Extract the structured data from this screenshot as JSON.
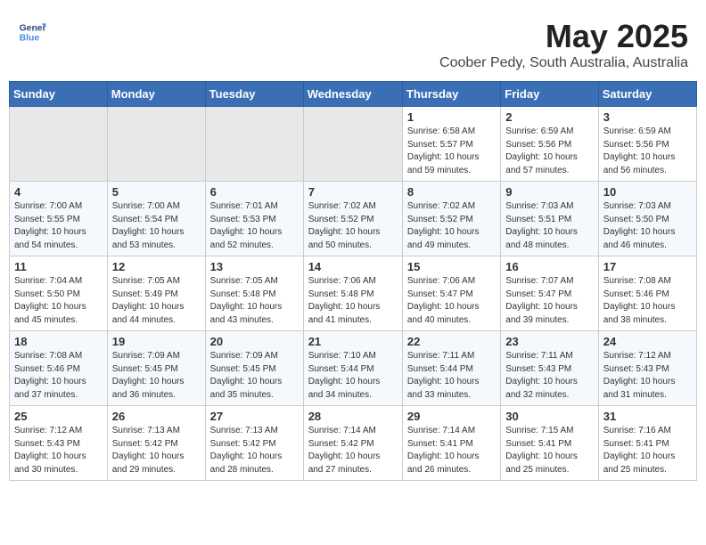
{
  "logo": {
    "line1": "General",
    "line2": "Blue"
  },
  "title": "May 2025",
  "subtitle": "Coober Pedy, South Australia, Australia",
  "days_of_week": [
    "Sunday",
    "Monday",
    "Tuesday",
    "Wednesday",
    "Thursday",
    "Friday",
    "Saturday"
  ],
  "weeks": [
    [
      {
        "day": "",
        "info": ""
      },
      {
        "day": "",
        "info": ""
      },
      {
        "day": "",
        "info": ""
      },
      {
        "day": "",
        "info": ""
      },
      {
        "day": "1",
        "info": "Sunrise: 6:58 AM\nSunset: 5:57 PM\nDaylight: 10 hours\nand 59 minutes."
      },
      {
        "day": "2",
        "info": "Sunrise: 6:59 AM\nSunset: 5:56 PM\nDaylight: 10 hours\nand 57 minutes."
      },
      {
        "day": "3",
        "info": "Sunrise: 6:59 AM\nSunset: 5:56 PM\nDaylight: 10 hours\nand 56 minutes."
      }
    ],
    [
      {
        "day": "4",
        "info": "Sunrise: 7:00 AM\nSunset: 5:55 PM\nDaylight: 10 hours\nand 54 minutes."
      },
      {
        "day": "5",
        "info": "Sunrise: 7:00 AM\nSunset: 5:54 PM\nDaylight: 10 hours\nand 53 minutes."
      },
      {
        "day": "6",
        "info": "Sunrise: 7:01 AM\nSunset: 5:53 PM\nDaylight: 10 hours\nand 52 minutes."
      },
      {
        "day": "7",
        "info": "Sunrise: 7:02 AM\nSunset: 5:52 PM\nDaylight: 10 hours\nand 50 minutes."
      },
      {
        "day": "8",
        "info": "Sunrise: 7:02 AM\nSunset: 5:52 PM\nDaylight: 10 hours\nand 49 minutes."
      },
      {
        "day": "9",
        "info": "Sunrise: 7:03 AM\nSunset: 5:51 PM\nDaylight: 10 hours\nand 48 minutes."
      },
      {
        "day": "10",
        "info": "Sunrise: 7:03 AM\nSunset: 5:50 PM\nDaylight: 10 hours\nand 46 minutes."
      }
    ],
    [
      {
        "day": "11",
        "info": "Sunrise: 7:04 AM\nSunset: 5:50 PM\nDaylight: 10 hours\nand 45 minutes."
      },
      {
        "day": "12",
        "info": "Sunrise: 7:05 AM\nSunset: 5:49 PM\nDaylight: 10 hours\nand 44 minutes."
      },
      {
        "day": "13",
        "info": "Sunrise: 7:05 AM\nSunset: 5:48 PM\nDaylight: 10 hours\nand 43 minutes."
      },
      {
        "day": "14",
        "info": "Sunrise: 7:06 AM\nSunset: 5:48 PM\nDaylight: 10 hours\nand 41 minutes."
      },
      {
        "day": "15",
        "info": "Sunrise: 7:06 AM\nSunset: 5:47 PM\nDaylight: 10 hours\nand 40 minutes."
      },
      {
        "day": "16",
        "info": "Sunrise: 7:07 AM\nSunset: 5:47 PM\nDaylight: 10 hours\nand 39 minutes."
      },
      {
        "day": "17",
        "info": "Sunrise: 7:08 AM\nSunset: 5:46 PM\nDaylight: 10 hours\nand 38 minutes."
      }
    ],
    [
      {
        "day": "18",
        "info": "Sunrise: 7:08 AM\nSunset: 5:46 PM\nDaylight: 10 hours\nand 37 minutes."
      },
      {
        "day": "19",
        "info": "Sunrise: 7:09 AM\nSunset: 5:45 PM\nDaylight: 10 hours\nand 36 minutes."
      },
      {
        "day": "20",
        "info": "Sunrise: 7:09 AM\nSunset: 5:45 PM\nDaylight: 10 hours\nand 35 minutes."
      },
      {
        "day": "21",
        "info": "Sunrise: 7:10 AM\nSunset: 5:44 PM\nDaylight: 10 hours\nand 34 minutes."
      },
      {
        "day": "22",
        "info": "Sunrise: 7:11 AM\nSunset: 5:44 PM\nDaylight: 10 hours\nand 33 minutes."
      },
      {
        "day": "23",
        "info": "Sunrise: 7:11 AM\nSunset: 5:43 PM\nDaylight: 10 hours\nand 32 minutes."
      },
      {
        "day": "24",
        "info": "Sunrise: 7:12 AM\nSunset: 5:43 PM\nDaylight: 10 hours\nand 31 minutes."
      }
    ],
    [
      {
        "day": "25",
        "info": "Sunrise: 7:12 AM\nSunset: 5:43 PM\nDaylight: 10 hours\nand 30 minutes."
      },
      {
        "day": "26",
        "info": "Sunrise: 7:13 AM\nSunset: 5:42 PM\nDaylight: 10 hours\nand 29 minutes."
      },
      {
        "day": "27",
        "info": "Sunrise: 7:13 AM\nSunset: 5:42 PM\nDaylight: 10 hours\nand 28 minutes."
      },
      {
        "day": "28",
        "info": "Sunrise: 7:14 AM\nSunset: 5:42 PM\nDaylight: 10 hours\nand 27 minutes."
      },
      {
        "day": "29",
        "info": "Sunrise: 7:14 AM\nSunset: 5:41 PM\nDaylight: 10 hours\nand 26 minutes."
      },
      {
        "day": "30",
        "info": "Sunrise: 7:15 AM\nSunset: 5:41 PM\nDaylight: 10 hours\nand 25 minutes."
      },
      {
        "day": "31",
        "info": "Sunrise: 7:16 AM\nSunset: 5:41 PM\nDaylight: 10 hours\nand 25 minutes."
      }
    ]
  ]
}
